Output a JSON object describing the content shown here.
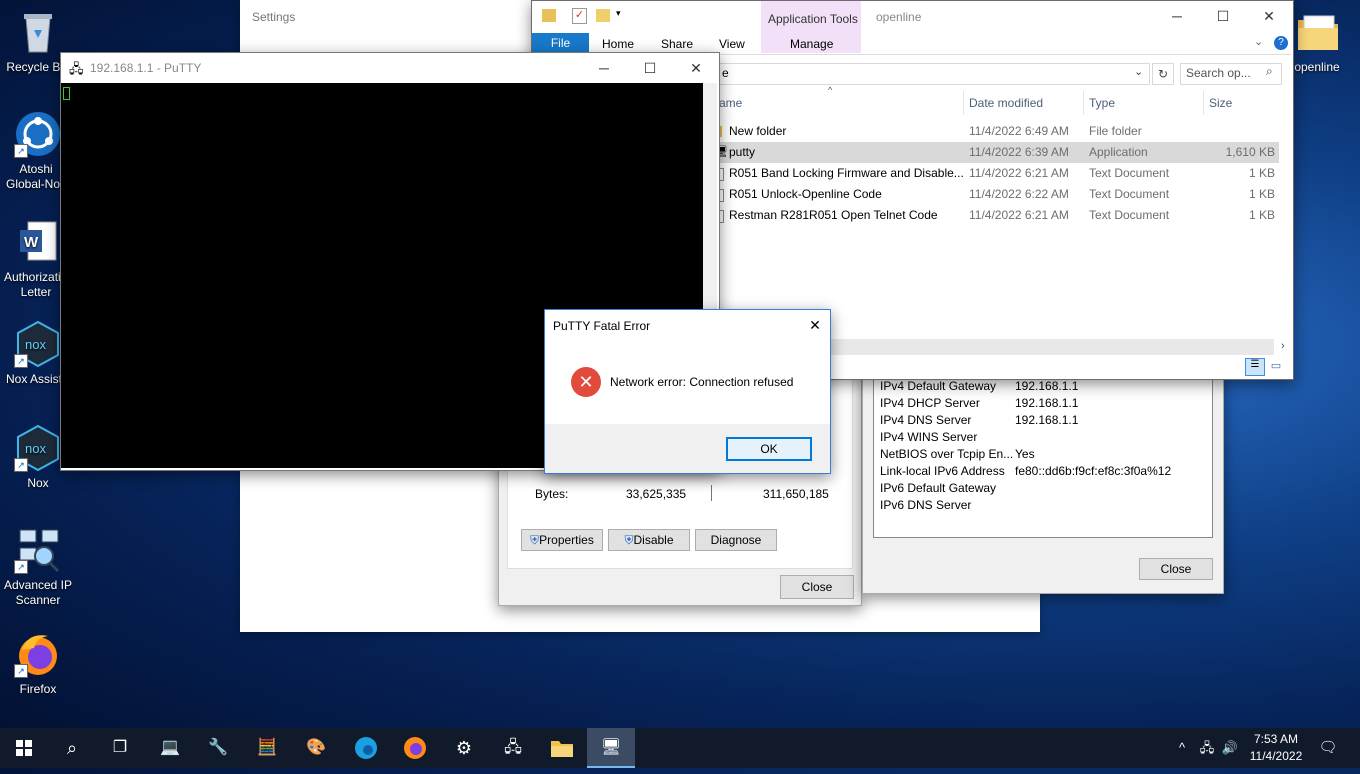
{
  "desktop": {
    "icons": [
      {
        "label": "Recycle Bin"
      },
      {
        "label": "Atoshi Global-Nox"
      },
      {
        "label": "Authorization Letter"
      },
      {
        "label": "Nox Assistant"
      },
      {
        "label": "Nox"
      },
      {
        "label": "Advanced IP Scanner"
      },
      {
        "label": "Firefox"
      },
      {
        "label": "openline"
      }
    ]
  },
  "settings": {
    "title": "Settings"
  },
  "putty": {
    "title": "192.168.1.1 - PuTTY"
  },
  "explorer": {
    "ribbon_context": "Application Tools",
    "title": "openline",
    "tabs": {
      "file": "File",
      "home": "Home",
      "share": "Share",
      "view": "View",
      "manage": "Manage"
    },
    "search_placeholder": "Search op...",
    "address_fragment": "e",
    "columns": {
      "name": "ame",
      "date": "Date modified",
      "type": "Type",
      "size": "Size"
    },
    "files": [
      {
        "name": "New folder",
        "date": "11/4/2022 6:49 AM",
        "type": "File folder",
        "size": ""
      },
      {
        "name": "putty",
        "date": "11/4/2022 6:39 AM",
        "type": "Application",
        "size": "1,610 KB"
      },
      {
        "name": "R051 Band Locking Firmware and Disable...",
        "date": "11/4/2022 6:21 AM",
        "type": "Text Document",
        "size": "1 KB"
      },
      {
        "name": "R051 Unlock-Openline Code",
        "date": "11/4/2022 6:22 AM",
        "type": "Text Document",
        "size": "1 KB"
      },
      {
        "name": "Restman R281R051 Open Telnet Code",
        "date": "11/4/2022 6:21 AM",
        "type": "Text Document",
        "size": "1 KB"
      }
    ]
  },
  "status": {
    "bytes_label": "Bytes:",
    "bytes_sent": "33,625,335",
    "bytes_received": "311,650,185",
    "properties": "Properties",
    "disable": "Disable",
    "diagnose": "Diagnose",
    "close": "Close"
  },
  "details": {
    "rows": [
      {
        "label": "IPv4 Default Gateway",
        "value": "192.168.1.1"
      },
      {
        "label": "IPv4 DHCP Server",
        "value": "192.168.1.1"
      },
      {
        "label": "IPv4 DNS Server",
        "value": "192.168.1.1"
      },
      {
        "label": "IPv4 WINS Server",
        "value": ""
      },
      {
        "label": "NetBIOS over Tcpip En...",
        "value": "Yes"
      },
      {
        "label": "Link-local IPv6 Address",
        "value": "fe80::dd6b:f9cf:ef8c:3f0a%12"
      },
      {
        "label": "IPv6 Default Gateway",
        "value": ""
      },
      {
        "label": "IPv6 DNS Server",
        "value": ""
      }
    ],
    "close": "Close"
  },
  "error_dialog": {
    "title": "PuTTY Fatal Error",
    "message": "Network error: Connection refused",
    "ok": "OK"
  },
  "taskbar": {
    "time": "7:53 AM",
    "date": "11/4/2022"
  }
}
